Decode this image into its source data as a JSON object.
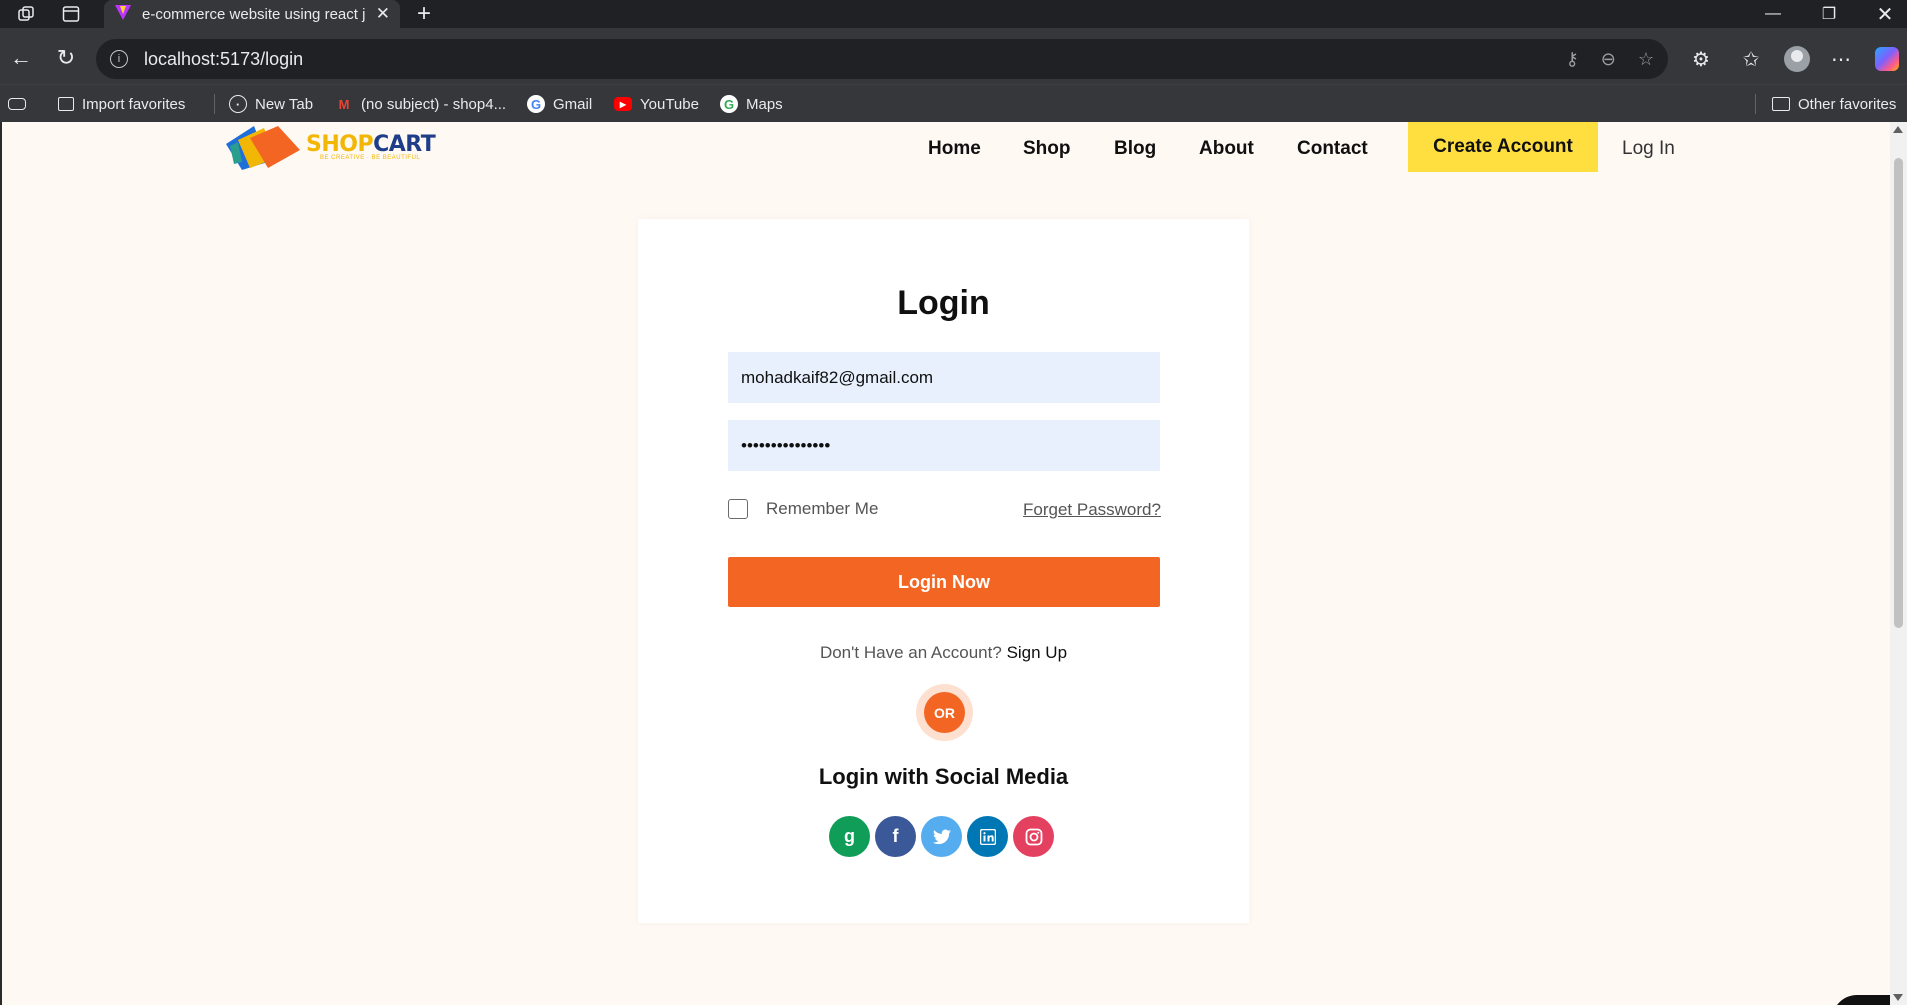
{
  "browser": {
    "tab_title": "e-commerce website using react j",
    "url": "localhost:5173/login",
    "bookmarks": [
      {
        "label": "Import favorites",
        "icon": "import-icon"
      },
      {
        "label": "New Tab",
        "icon": "globe-icon"
      },
      {
        "label": "(no subject) - shop4...",
        "icon": "gmail-icon"
      },
      {
        "label": "Gmail",
        "icon": "google-icon"
      },
      {
        "label": "YouTube",
        "icon": "youtube-icon"
      },
      {
        "label": "Maps",
        "icon": "google-icon"
      }
    ],
    "other_favorites": "Other favorites"
  },
  "header": {
    "logo": {
      "shop": "SHOP",
      "cart": "CART",
      "tagline": "BE CREATIVE · BE BEAUTIFUL"
    },
    "nav": [
      "Home",
      "Shop",
      "Blog",
      "About",
      "Contact"
    ],
    "create_account": "Create Account",
    "login": "Log In"
  },
  "login": {
    "title": "Login",
    "email_value": "mohadkaif82@gmail.com",
    "password_value": "•••••••••••••••",
    "remember_label": "Remember Me",
    "forget_label": "Forget Password?",
    "submit_label": "Login Now",
    "no_account_text": "Don't Have an Account?",
    "signup_label": "Sign Up",
    "or_label": "OR",
    "social_title": "Login with Social Media",
    "socials": [
      {
        "name": "google",
        "glyph": "g",
        "color": "#0f9d58"
      },
      {
        "name": "facebook",
        "glyph": "f",
        "color": "#3b5998"
      },
      {
        "name": "twitter",
        "glyph": "🐦",
        "color": "#55acee"
      },
      {
        "name": "linkedin",
        "glyph": "in",
        "color": "#0077b5"
      },
      {
        "name": "instagram",
        "glyph": "◎",
        "color": "#e4405f"
      }
    ]
  },
  "colors": {
    "accent": "#f26522",
    "cta": "#ffdf40",
    "page_bg": "#fff9f4",
    "input_bg": "#e8f0fe"
  }
}
